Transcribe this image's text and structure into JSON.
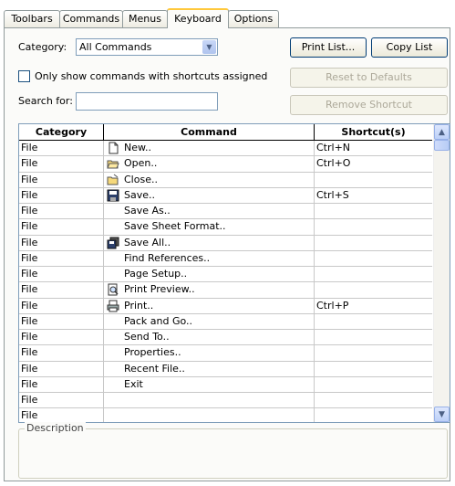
{
  "tabs": [
    "Toolbars",
    "Commands",
    "Menus",
    "Keyboard",
    "Options"
  ],
  "active_tab": "Keyboard",
  "category_label": "Category:",
  "category_value": "All Commands",
  "only_shortcuts_label": "Only show commands with shortcuts assigned",
  "search_label": "Search for:",
  "search_value": "",
  "buttons": {
    "print_list": "Print List...",
    "copy_list": "Copy List",
    "reset": "Reset to Defaults",
    "remove": "Remove Shortcut"
  },
  "grid": {
    "headers": [
      "Category",
      "Command",
      "Shortcut(s)"
    ],
    "rows": [
      {
        "category": "File",
        "command": "New..",
        "shortcut": "Ctrl+N",
        "icon": "new-document-icon"
      },
      {
        "category": "File",
        "command": "Open..",
        "shortcut": "Ctrl+O",
        "icon": "open-folder-icon"
      },
      {
        "category": "File",
        "command": "Close..",
        "shortcut": "",
        "icon": "close-folder-icon"
      },
      {
        "category": "File",
        "command": "Save..",
        "shortcut": "Ctrl+S",
        "icon": "save-disk-icon"
      },
      {
        "category": "File",
        "command": "Save As..",
        "shortcut": "",
        "icon": ""
      },
      {
        "category": "File",
        "command": "Save Sheet Format..",
        "shortcut": "",
        "icon": ""
      },
      {
        "category": "File",
        "command": "Save All..",
        "shortcut": "",
        "icon": "save-all-icon"
      },
      {
        "category": "File",
        "command": "Find References..",
        "shortcut": "",
        "icon": ""
      },
      {
        "category": "File",
        "command": "Page Setup..",
        "shortcut": "",
        "icon": ""
      },
      {
        "category": "File",
        "command": "Print Preview..",
        "shortcut": "",
        "icon": "print-preview-icon"
      },
      {
        "category": "File",
        "command": "Print..",
        "shortcut": "Ctrl+P",
        "icon": "printer-icon"
      },
      {
        "category": "File",
        "command": "Pack and Go..",
        "shortcut": "",
        "icon": ""
      },
      {
        "category": "File",
        "command": "Send To..",
        "shortcut": "",
        "icon": ""
      },
      {
        "category": "File",
        "command": "Properties..",
        "shortcut": "",
        "icon": ""
      },
      {
        "category": "File",
        "command": "Recent File..",
        "shortcut": "",
        "icon": ""
      },
      {
        "category": "File",
        "command": "Exit",
        "shortcut": "",
        "icon": ""
      },
      {
        "category": "File",
        "command": "",
        "shortcut": "",
        "icon": ""
      },
      {
        "category": "File",
        "command": "",
        "shortcut": "",
        "icon": ""
      }
    ]
  },
  "description_label": "Description"
}
